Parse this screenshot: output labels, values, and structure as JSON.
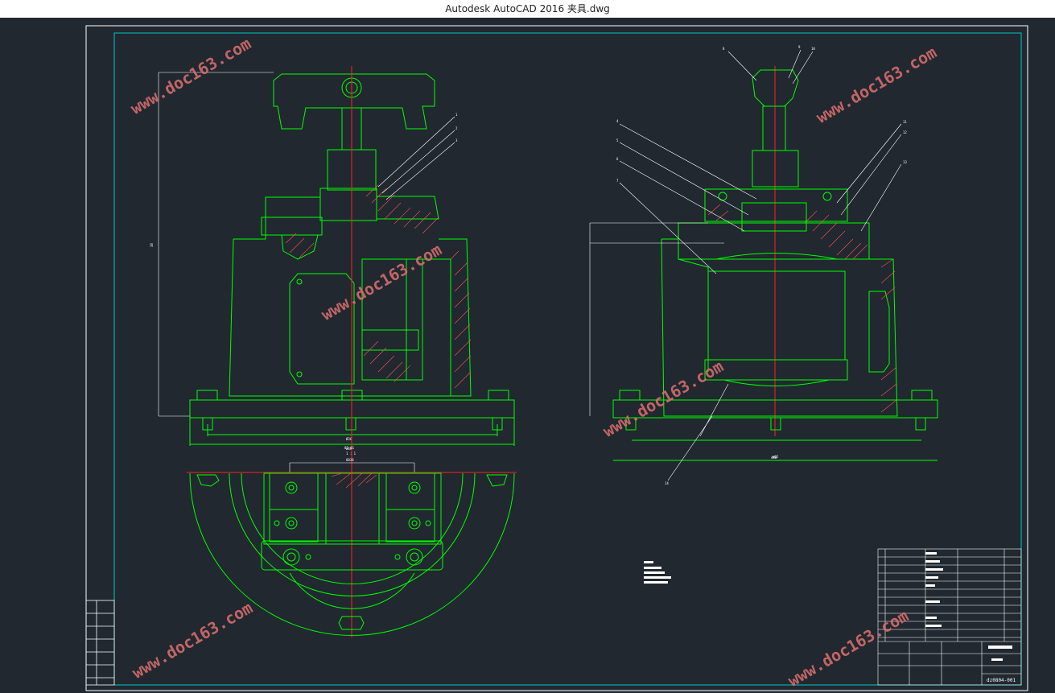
{
  "window": {
    "app": "Autodesk AutoCAD 2016",
    "file": "夹具.dwg",
    "title": "Autodesk AutoCAD 2016    夹具.dwg"
  },
  "watermark": "www.doc163.com",
  "colors": {
    "background": "#212830",
    "border": "#ffffff",
    "frame": "#00c8c8",
    "geometry": "#00ff00",
    "centerline": "#ff2020",
    "hatch": "#ff5050",
    "watermark": "#e07070"
  },
  "drawing": {
    "front_view": {
      "dim_bottom_1": "Ø38",
      "dim_bottom_2": "ø68",
      "dim_height": "38",
      "leaders": [
        "1",
        "2",
        "3"
      ]
    },
    "section_marker": {
      "line1": "85-81",
      "line2": "1 : 1",
      "line3": "8828"
    },
    "side_view": {
      "leaders": [
        "4",
        "5",
        "6",
        "7",
        "8",
        "9",
        "10",
        "11",
        "12",
        "13",
        "14"
      ],
      "dim_width": "480",
      "dim_base": "ø65"
    },
    "title_block": {
      "drawing_no": "dz0804-001"
    }
  }
}
